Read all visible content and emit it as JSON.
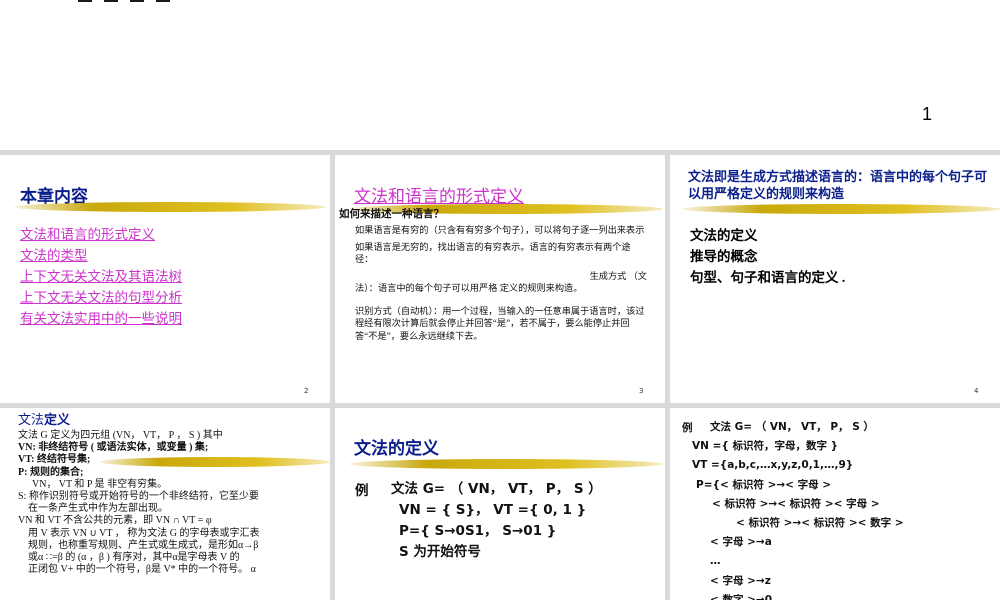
{
  "top": {
    "page_number": "1"
  },
  "slide1": {
    "title": "本章内容",
    "links": [
      "文法和语言的形式定义",
      "文法的类型",
      "上下文无关文法及其语法树",
      "上下文无关文法的句型分析",
      "有关文法实用中的一些说明"
    ],
    "page": "2"
  },
  "slide2": {
    "title": "文法和语言的形式定义",
    "question": "如何来描述一种语言？",
    "p1": "如果语言是有穷的（只含有有穷多个句子），可以将句子逐一列出来表示",
    "p2": "如果语言是无穷的，找出语言的有穷表示。语言的有穷表示有两个途径：",
    "p3a": "生成方式 （文",
    "p3b": "法）：语言中的每个句子可以用严格 定义的规则来构造。",
    "p4": "识别方式（自动机）：用一个过程，当输入的一任意串属于语言时，该过程经有限次计算后就会停止并回答“是”，若不属于，要么能停止并回答“不是”，要么永远继续下去。",
    "page": "3"
  },
  "slide3": {
    "title": "文法即是生成方式描述语言的：语言中的每个句子可以用严格定义的规则来构造",
    "items": [
      "文法的定义",
      "推导的概念",
      "句型、句子和语言的定义 ."
    ],
    "page": "4"
  },
  "slide4": {
    "title_a": "文法",
    "title_b": "定义",
    "l1": "文法 G 定义为四元组 (VN， VT， P ， S ) 其中",
    "l2": "VN: 非终结符号 ( 或语法实体，或变量 ) 集;",
    "l3": "VT: 终结符号集;",
    "l4": "P:  规则的集合;",
    "l5": "VN， VT 和 P 是 非空有穷集。",
    "l6": "S: 称作识别符号或开始符号的一个非终结符，它至少要",
    "l7": "在一条产生式中作为左部出现。",
    "l8": "VN 和 VT 不含公共的元素，即 VN ∩ VT = φ",
    "l9": "用 V 表示 VN ∪ VT ， 称为文法 G 的字母表或字汇表",
    "l10": "规则，也称重写规则、产生式或生成式，是形如α→β",
    "l11": "或α ∷=β 的 (α ，β ) 有序对，其中α是字母表 V 的",
    "l12": "正闭包 V+ 中的一个符号，β是 V* 中的一个符号。 α"
  },
  "slide5": {
    "title": "文法的定义",
    "example_label": "例",
    "lines": [
      "文法 G= （ VN， VT， P， S ）",
      "VN = { S}， VT ={ 0, 1 }",
      "P={ S→0S1， S→01 }",
      "S 为开始符号"
    ]
  },
  "slide6": {
    "example_label": "例",
    "lines": [
      "文法 G= （ VN， VT， P， S ）",
      "VN ={ 标识符，字母，数字 }",
      "VT ={a,b,c,…x,y,z,0,1,…,9}",
      "P={< 标识符 >→< 字母 >",
      "< 标识符 >→< 标识符 >< 字母 >",
      "< 标识符 >→< 标识符 >< 数字 >",
      "< 字母 >→a",
      "…",
      "< 字母 >→z",
      "< 数字 >→0"
    ]
  }
}
